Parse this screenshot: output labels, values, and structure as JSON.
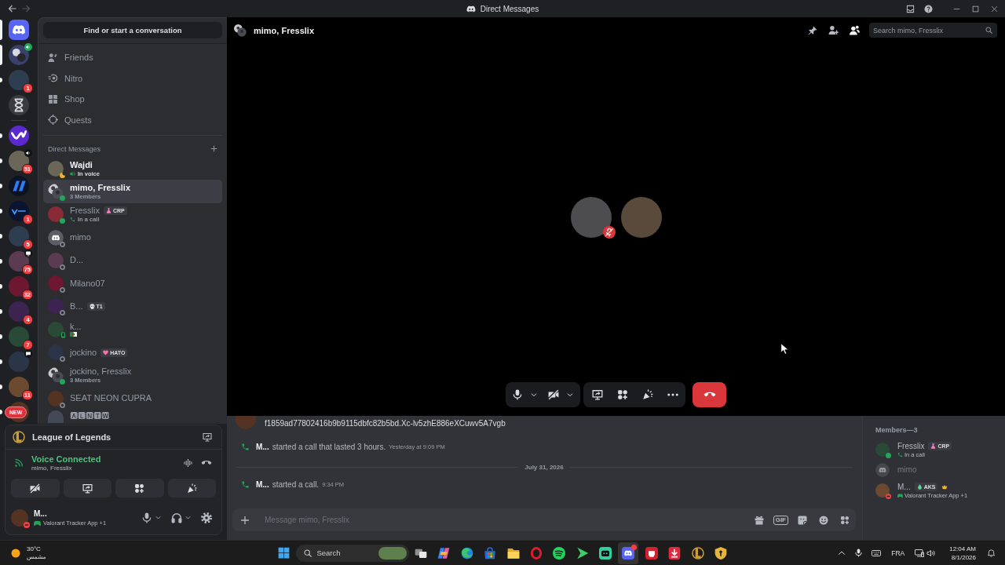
{
  "window": {
    "title": "Direct Messages"
  },
  "rail": {
    "home": {
      "selected": true
    },
    "dms": [
      {
        "kind": "group",
        "active": true,
        "unread": false
      },
      {
        "kind": "photo",
        "active": false,
        "unread": true,
        "badge": "1"
      },
      {
        "kind": "tile",
        "active": false,
        "unread": false
      }
    ],
    "servers": [
      {
        "kind": "tile",
        "active": false,
        "unread": true
      },
      {
        "kind": "photo",
        "active": false,
        "unread": true,
        "badge": "51"
      },
      {
        "kind": "tile",
        "active": false,
        "unread": true
      },
      {
        "kind": "tile",
        "active": false,
        "unread": true,
        "badge": "1"
      },
      {
        "kind": "photo",
        "active": false,
        "unread": true,
        "badge": "5"
      },
      {
        "kind": "photo",
        "active": false,
        "unread": true,
        "badge": "75"
      },
      {
        "kind": "photo",
        "active": false,
        "unread": true,
        "badge": "32"
      },
      {
        "kind": "photo",
        "active": false,
        "unread": true,
        "badge": "4"
      },
      {
        "kind": "photo",
        "active": false,
        "unread": true,
        "badge": "7"
      },
      {
        "kind": "photo",
        "active": false,
        "unread": true
      },
      {
        "kind": "photo",
        "active": false,
        "unread": true,
        "badge": "11"
      },
      {
        "kind": "photo",
        "active": false,
        "unread": true,
        "new_label": "NEW"
      }
    ]
  },
  "sidebar": {
    "search_button": "Find or start a conversation",
    "nav": [
      {
        "label": "Friends",
        "selected": false
      },
      {
        "label": "Nitro",
        "selected": false
      },
      {
        "label": "Shop",
        "selected": false
      },
      {
        "label": "Quests",
        "selected": false
      }
    ],
    "dm_header": "Direct Messages",
    "dms": [
      {
        "name": "Wajdi",
        "kind": "photo",
        "status": {
          "kind": "idle"
        },
        "subtitle": "In voice",
        "unread": true,
        "selected": false
      },
      {
        "name": "mimo, Fresslix",
        "kind": "group",
        "status": {
          "kind": "online"
        },
        "subtitle": "3 Members",
        "unread": false,
        "selected": true
      },
      {
        "name": "Fresslix",
        "kind": "photo",
        "status": {
          "kind": "online"
        },
        "tag": "CRP",
        "subtitle": "In a call",
        "unread": false,
        "selected": false
      },
      {
        "name": "mimo",
        "kind": "default",
        "status": {
          "kind": "offline"
        },
        "unread": false,
        "selected": false
      },
      {
        "name": "D...",
        "kind": "photo",
        "status": {
          "kind": "offline"
        },
        "unread": false,
        "selected": false
      },
      {
        "name": "Milano07",
        "kind": "photo",
        "status": {
          "kind": "offline"
        },
        "unread": false,
        "selected": false
      },
      {
        "name": "B...",
        "kind": "photo",
        "status": {
          "kind": "offline"
        },
        "tag": "T1",
        "unread": false,
        "selected": false
      },
      {
        "name": "k...",
        "kind": "photo",
        "status": {
          "kind": "mobile"
        },
        "unread": false,
        "selected": false
      },
      {
        "name": "jockino",
        "kind": "photo",
        "status": {
          "kind": "offline"
        },
        "tag": "HATO",
        "unread": false,
        "selected": false
      },
      {
        "name": "jockino, Fresslix",
        "kind": "group",
        "status": {
          "kind": "online"
        },
        "subtitle": "3 Members",
        "unread": false,
        "selected": false
      },
      {
        "name": "SEAT NEON CUPRA",
        "kind": "photo",
        "status": {
          "kind": "offline"
        },
        "unread": false,
        "selected": false
      },
      {
        "name": "🅰🅻🅽🆃🆆",
        "kind": "photo",
        "unread": false,
        "selected": false
      }
    ]
  },
  "voice_panel": {
    "activity": {
      "title": "League of Legends"
    },
    "connection": {
      "status": "Voice Connected",
      "channel": "mimo, Fresslix"
    },
    "camera_on": false
  },
  "user": {
    "name": "M...",
    "status": {
      "kind": "dnd"
    },
    "activity": "Valorant Tracker App +1"
  },
  "header": {
    "title": "mimo, Fresslix",
    "members_shown": true,
    "search": {
      "placeholder": "Search mimo, Fresslix"
    }
  },
  "call": {
    "participants": [
      {
        "muted": true
      },
      {
        "muted": false
      }
    ],
    "mic_on": true,
    "camera_on": false
  },
  "chat": {
    "messages": [
      {
        "kind": "text",
        "text": "f1859ad77802416b9b9115dbfc82b5bd.Xc-lv5zhE886eXCuwv5A7vgb"
      },
      {
        "kind": "call",
        "author": "M...",
        "text": "started a call that lasted 3 hours.",
        "time": "Yesterday at 9:09 PM"
      },
      {
        "kind": "date",
        "text": "July 31, 2026"
      },
      {
        "kind": "call",
        "author": "M...",
        "text": "started a call.",
        "time": "9:34 PM"
      }
    ],
    "input": {
      "placeholder": "Message mimo, Fresslix",
      "gif_label": "GIF"
    }
  },
  "members": {
    "title": "Members—3",
    "items": [
      {
        "name": "Fresslix",
        "status": {
          "kind": "online"
        },
        "tag": "CRP",
        "subtitle": "In a call",
        "owner": false
      },
      {
        "name": "mimo",
        "status": {
          "kind": "offline"
        },
        "owner": false
      },
      {
        "name": "M...",
        "status": {
          "kind": "dnd"
        },
        "tag": "AKS",
        "subtitle": "Valorant Tracker App +1",
        "owner": true
      }
    ]
  },
  "taskbar": {
    "weather": {
      "temperature": "30°C",
      "condition": "مشمس"
    },
    "search_label": "Search",
    "apps": [
      {
        "active": false,
        "notification": false
      },
      {
        "active": false,
        "notification": false
      },
      {
        "active": false,
        "notification": false
      },
      {
        "active": false,
        "notification": false
      },
      {
        "active": false,
        "notification": false
      },
      {
        "active": false,
        "notification": false
      },
      {
        "active": false,
        "notification": false
      },
      {
        "active": false,
        "notification": false
      },
      {
        "active": false,
        "notification": false
      },
      {
        "active": true,
        "notification": true
      },
      {
        "active": false,
        "notification": false
      },
      {
        "active": false,
        "notification": false
      },
      {
        "active": false,
        "notification": false
      },
      {
        "active": false,
        "notification": false
      }
    ],
    "tray": {
      "language": "FRA",
      "time": "12:04 AM",
      "date": "8/1/2026"
    }
  }
}
